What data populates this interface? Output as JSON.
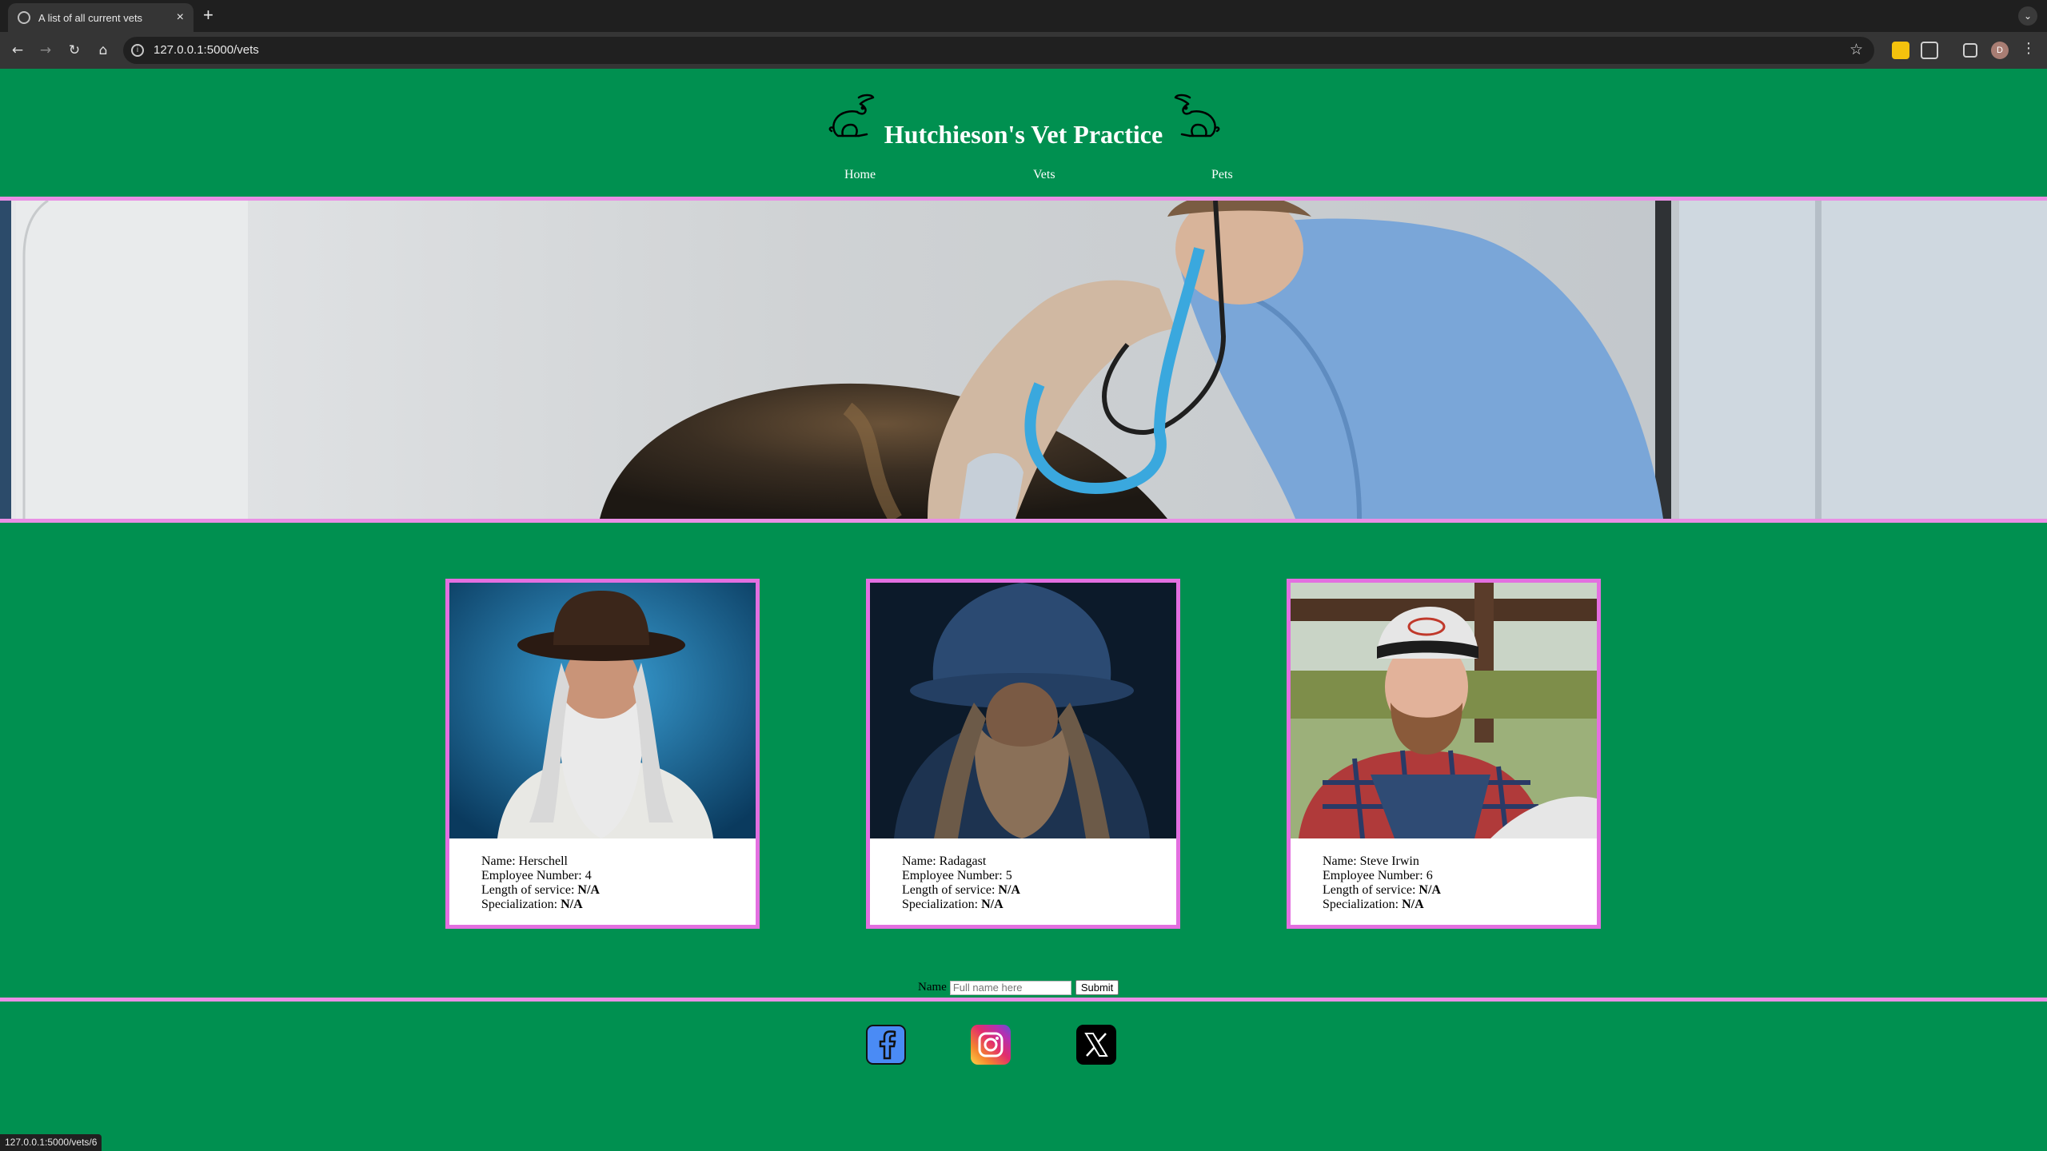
{
  "browser": {
    "tab_title": "A list of all current vets",
    "new_tab": "+",
    "tab_close": "×",
    "url": "127.0.0.1:5000/vets",
    "profile_initial": "D",
    "status_url": "127.0.0.1:5000/vets/6"
  },
  "site": {
    "title": "Hutchieson's Vet Practice",
    "nav": [
      "Home",
      "Vets",
      "Pets"
    ]
  },
  "vets": [
    {
      "name_label": "Name: Herschell",
      "employee_label": "Employee Number: 4",
      "service_prefix": "Length of service: ",
      "service_value": "N/A",
      "spec_prefix": "Specialization: ",
      "spec_value": "N/A"
    },
    {
      "name_label": "Name: Radagast",
      "employee_label": "Employee Number: 5",
      "service_prefix": "Length of service: ",
      "service_value": "N/A",
      "spec_prefix": "Specialization: ",
      "spec_value": "N/A"
    },
    {
      "name_label": "Name: Steve Irwin",
      "employee_label": "Employee Number: 6",
      "service_prefix": "Length of service: ",
      "service_value": "N/A",
      "spec_prefix": "Specialization: ",
      "spec_value": "N/A"
    }
  ],
  "form": {
    "label": "Name",
    "placeholder": "Full name here",
    "submit": "Submit"
  },
  "colors": {
    "page_bg": "#009050",
    "accent_border": "#e98fe5"
  }
}
